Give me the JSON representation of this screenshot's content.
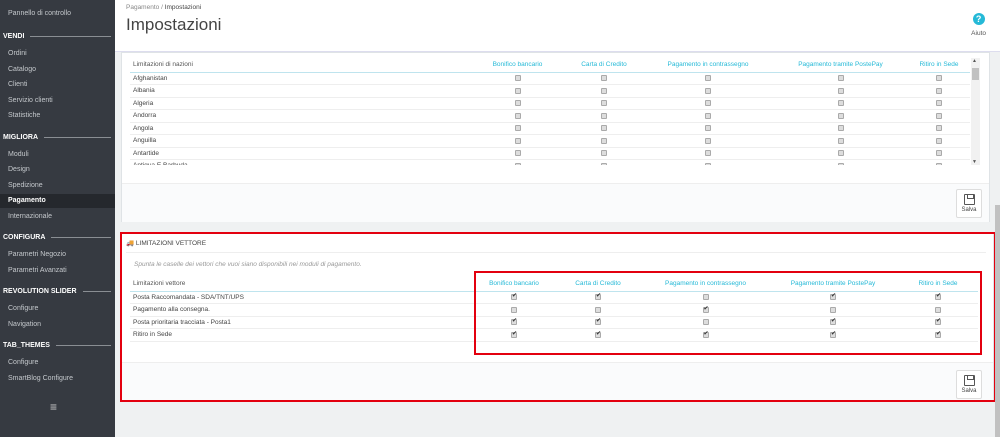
{
  "sidebar": {
    "dashboard": "Pannello di controllo",
    "sections": [
      {
        "title": "VENDI",
        "items": [
          "Ordini",
          "Catalogo",
          "Clienti",
          "Servizio clienti",
          "Statistiche"
        ]
      },
      {
        "title": "MIGLIORA",
        "items": [
          "Moduli",
          "Design",
          "Spedizione",
          "Pagamento",
          "Internazionale"
        ]
      },
      {
        "title": "CONFIGURA",
        "items": [
          "Parametri Negozio",
          "Parametri Avanzati"
        ]
      },
      {
        "title": "REVOLUTION SLIDER",
        "items": [
          "Configure",
          "Navigation"
        ]
      },
      {
        "title": "TAB_THEMES",
        "items": [
          "Configure",
          "SmartBlog Configure"
        ]
      }
    ],
    "active": "Pagamento",
    "menu_icon": "hamburger-icon"
  },
  "header": {
    "breadcrumb": [
      "Pagamento",
      "Impostazioni"
    ],
    "separator": "/",
    "title": "Impostazioni",
    "help_label": "Aiuto"
  },
  "countries": {
    "header": "Limitazioni di nazioni",
    "columns": [
      "Bonifico bancario",
      "Carta di Credito",
      "Pagamento in contrassegno",
      "Pagamento tramite PostePay",
      "Ritiro in Sede"
    ],
    "rows": [
      "Afghanistan",
      "Albania",
      "Algeria",
      "Andorra",
      "Angola",
      "Anguilla",
      "Antartide",
      "Antigua E Barbuda"
    ],
    "save_label": "Salva"
  },
  "carriers": {
    "title": "LIMITAZIONI VETTORE",
    "hint": "Spunta le caselle dei vettori che vuoi siano disponibili nei moduli di pagamento.",
    "header": "Limitazioni vettore",
    "columns": [
      "Bonifico bancario",
      "Carta di Credito",
      "Pagamento in contrassegno",
      "Pagamento tramite PostePay",
      "Ritiro in Sede"
    ],
    "rows": [
      {
        "name": "Posta Raccomandata - SDA/TNT/UPS",
        "checked": [
          true,
          true,
          false,
          true,
          true
        ]
      },
      {
        "name": "Pagamento alla consegna.",
        "checked": [
          false,
          false,
          true,
          false,
          false
        ]
      },
      {
        "name": "Posta prioritaria tracciata - Posta1",
        "checked": [
          true,
          true,
          false,
          true,
          true
        ]
      },
      {
        "name": "Ritiro in Sede",
        "checked": [
          true,
          true,
          true,
          true,
          true
        ]
      }
    ],
    "save_label": "Salva",
    "highlight_color": "#e3000f"
  }
}
